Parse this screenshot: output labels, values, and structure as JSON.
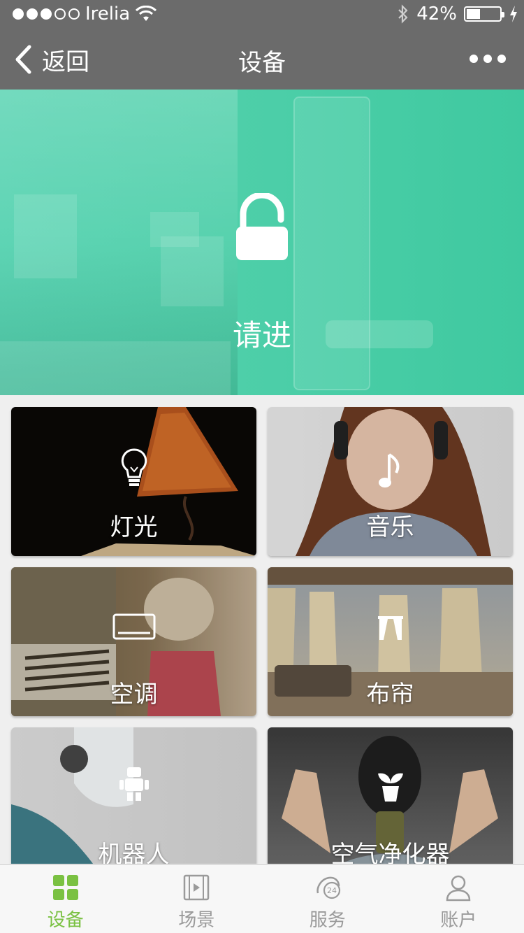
{
  "status_bar": {
    "carrier": "Irelia",
    "signal_bars": 3,
    "signal_total": 5,
    "battery_percent": "42%",
    "battery_level": 0.42
  },
  "nav": {
    "back_label": "返回",
    "title": "设备"
  },
  "hero": {
    "label": "请进",
    "icon": "unlock-icon",
    "color": "#4ecfa9"
  },
  "devices": [
    {
      "label": "灯光",
      "icon": "lightbulb-icon"
    },
    {
      "label": "音乐",
      "icon": "music-note-icon"
    },
    {
      "label": "空调",
      "icon": "air-conditioner-icon"
    },
    {
      "label": "布帘",
      "icon": "curtain-icon"
    },
    {
      "label": "机器人",
      "icon": "robot-icon"
    },
    {
      "label": "空气净化器",
      "icon": "plant-pot-icon"
    }
  ],
  "tabs": [
    {
      "label": "设备",
      "icon": "grid-icon",
      "active": true
    },
    {
      "label": "场景",
      "icon": "film-icon",
      "active": false
    },
    {
      "label": "服务",
      "icon": "phone-24h-icon",
      "active": false
    },
    {
      "label": "账户",
      "icon": "person-icon",
      "active": false
    }
  ],
  "colors": {
    "bar": "#6b6b6b",
    "tab_active": "#7ac142",
    "tab_inactive": "#9a9a9a"
  }
}
